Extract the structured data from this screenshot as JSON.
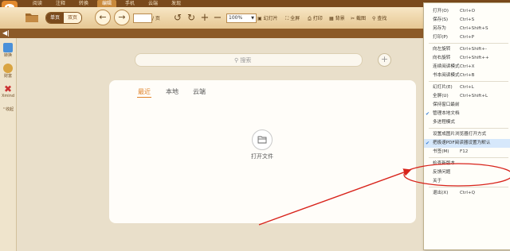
{
  "tabs": [
    "阅读",
    "注释",
    "转换",
    "编辑",
    "手机",
    "云端",
    "发现"
  ],
  "toolbar": {
    "view_single": "单页",
    "view_double": "双页",
    "page_value": "",
    "page_suffix": "/ 页",
    "zoom": "100%",
    "slideshow": "幻灯片",
    "fullscreen": "全屏",
    "print": "打印",
    "background": "背景",
    "screenshot": "截图",
    "find": "查找"
  },
  "sidebar": {
    "items": [
      {
        "label": "转换",
        "icon": "convert-icon",
        "color": "#4a90d9"
      },
      {
        "label": "财富",
        "icon": "wealth-icon",
        "color": "#d9a441"
      },
      {
        "label": "Xmind",
        "icon": "xmind-icon",
        "color": "#c33"
      }
    ],
    "collapse_label": "收起"
  },
  "search": {
    "placeholder": "搜索"
  },
  "panel": {
    "tabs": [
      "最近",
      "本地",
      "云端"
    ],
    "active_tab": "最近",
    "open_file_label": "打开文件"
  },
  "menu": {
    "items": [
      {
        "label": "打开(O)",
        "shortcut": "Ctrl+O",
        "checked": false
      },
      {
        "label": "保存(S)",
        "shortcut": "Ctrl+S",
        "checked": false
      },
      {
        "label": "另存为",
        "shortcut": "Ctrl+Shift+S",
        "checked": false
      },
      {
        "label": "打印(P)",
        "shortcut": "Ctrl+P",
        "checked": false
      },
      {
        "sep": true
      },
      {
        "label": "向左旋转",
        "shortcut": "Ctrl+Shift+-",
        "checked": false
      },
      {
        "label": "向右旋转",
        "shortcut": "Ctrl+Shift++",
        "checked": false
      },
      {
        "label": "连续阅读模式",
        "shortcut": "Ctrl+X",
        "checked": false
      },
      {
        "label": "书本阅读模式",
        "shortcut": "Ctrl+B",
        "checked": false
      },
      {
        "sep": true
      },
      {
        "label": "幻灯片(E)",
        "shortcut": "Ctrl+L",
        "checked": false
      },
      {
        "label": "全屏(U)",
        "shortcut": "Ctrl+Shift+L",
        "checked": false
      },
      {
        "label": "保持窗口最前",
        "shortcut": "",
        "checked": false
      },
      {
        "label": "管理本地文档",
        "shortcut": "",
        "checked": true
      },
      {
        "label": "多进程模式",
        "shortcut": "",
        "checked": false
      },
      {
        "sep": true
      },
      {
        "label": "设置成图片浏览器打开方式",
        "shortcut": "",
        "checked": false
      },
      {
        "label": "把极速PDF阅读器设置为默认",
        "shortcut": "",
        "checked": true,
        "highlight": true
      },
      {
        "label": "书签(M)",
        "shortcut": "F12",
        "checked": false
      },
      {
        "sep": true
      },
      {
        "label": "检查新版本",
        "shortcut": "",
        "checked": false
      },
      {
        "label": "反馈问题",
        "shortcut": "",
        "checked": false
      },
      {
        "label": "关于",
        "shortcut": "",
        "checked": false
      },
      {
        "sep": true
      },
      {
        "label": "退出(X)",
        "shortcut": "Ctrl+Q",
        "checked": false
      }
    ]
  },
  "colors": {
    "accent": "#e0822a",
    "annotation": "#d8231b",
    "toolbar_brown": "#7a4a1c"
  }
}
